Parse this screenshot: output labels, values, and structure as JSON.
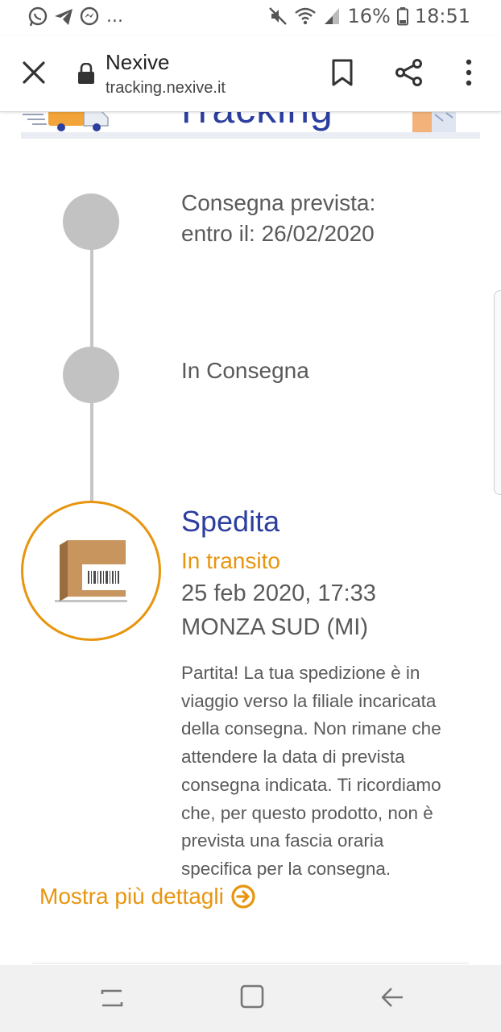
{
  "status_bar": {
    "left_icons": [
      "whatsapp-icon",
      "telegram-icon",
      "messenger-icon"
    ],
    "dots": "...",
    "battery": "16%",
    "time": "18:51"
  },
  "toolbar": {
    "title": "Nexive",
    "url": "tracking.nexive.it"
  },
  "banner": {
    "word": "Tracking"
  },
  "timeline": {
    "steps": [
      {
        "line1": "Consegna prevista:",
        "line2": "entro il: 26/02/2020"
      },
      {
        "label": "In Consegna"
      }
    ],
    "current": {
      "title": "Spedita",
      "status": "In transito",
      "datetime": "25 feb 2020, 17:33",
      "location": "MONZA SUD (MI)",
      "description_lines": [
        "Partita! La tua spedizione è in",
        "viaggio verso la filiale incaricata",
        "della consegna. Non rimane che",
        "attendere la data di prevista",
        "consegna indicata. Ti ricordiamo",
        "che, per questo prodotto, non è",
        "prevista una fascia oraria",
        "specifica per la consegna."
      ]
    }
  },
  "more_details": {
    "label": "Mostra più dettagli"
  },
  "colors": {
    "brand_blue": "#2c3e9e",
    "accent_orange": "#e8950e",
    "timeline_grey": "#c2c2c2"
  }
}
